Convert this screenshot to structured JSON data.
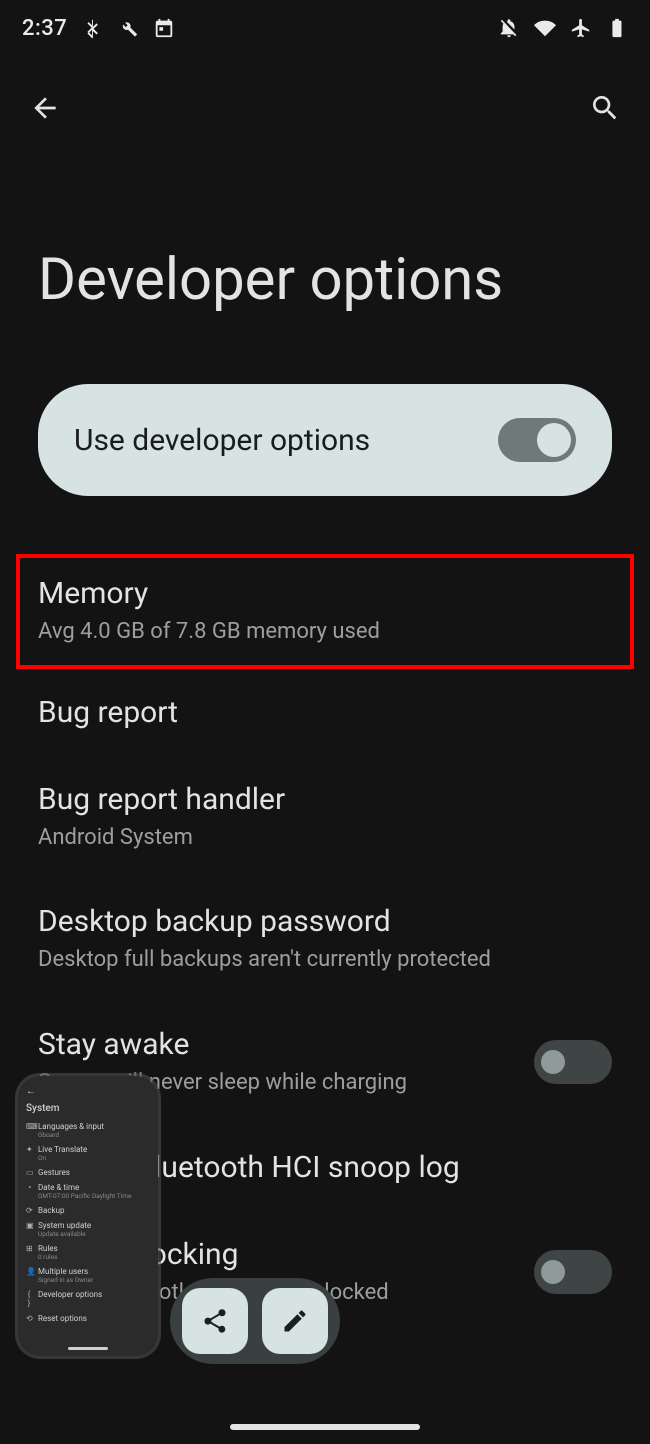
{
  "status_bar": {
    "time": "2:37",
    "icons_left": [
      "bluetooth-icon",
      "wrench-icon",
      "calendar-icon"
    ],
    "icons_right": [
      "dnd-off-icon",
      "wifi-icon",
      "airplane-icon",
      "battery-icon"
    ]
  },
  "app_bar": {
    "back": "back",
    "search": "search"
  },
  "page_title": "Developer options",
  "master_toggle": {
    "label": "Use developer options",
    "state": "on"
  },
  "settings": [
    {
      "key": "memory",
      "title": "Memory",
      "summary": "Avg 4.0 GB of 7.8 GB memory used",
      "highlighted": true
    },
    {
      "key": "bug-report",
      "title": "Bug report"
    },
    {
      "key": "bug-report-handler",
      "title": "Bug report handler",
      "summary": "Android System"
    },
    {
      "key": "desktop-backup-password",
      "title": "Desktop backup password",
      "summary": "Desktop full backups aren't currently protected"
    },
    {
      "key": "stay-awake",
      "title": "Stay awake",
      "summary": "Screen will never sleep while charging",
      "toggle": "off"
    },
    {
      "key": "bt-hci-snoop",
      "title": "Enable Bluetooth HCI snoop log"
    },
    {
      "key": "oem-unlock",
      "title": "OEM unlocking",
      "summary": "Allow the bootloader to be unlocked",
      "toggle": "off"
    }
  ],
  "recents_thumbnail": {
    "title": "System",
    "rows": [
      {
        "icon": "⌨",
        "label": "Languages & input",
        "sub": "Gboard"
      },
      {
        "icon": "✦",
        "label": "Live Translate",
        "sub": "On"
      },
      {
        "icon": "▭",
        "label": "Gestures"
      },
      {
        "icon": "◔",
        "label": "Date & time",
        "sub": "GMT-07:00 Pacific Daylight Time"
      },
      {
        "icon": "⟳",
        "label": "Backup"
      },
      {
        "icon": "▣",
        "label": "System update",
        "sub": "Update available"
      },
      {
        "icon": "⊞",
        "label": "Rules",
        "sub": "0 rules"
      },
      {
        "icon": "👤",
        "label": "Multiple users",
        "sub": "Signed in as Owner"
      },
      {
        "icon": "{ }",
        "label": "Developer options"
      },
      {
        "icon": "⟲",
        "label": "Reset options"
      }
    ]
  },
  "share_bar": {
    "share": "share",
    "edit": "edit"
  }
}
